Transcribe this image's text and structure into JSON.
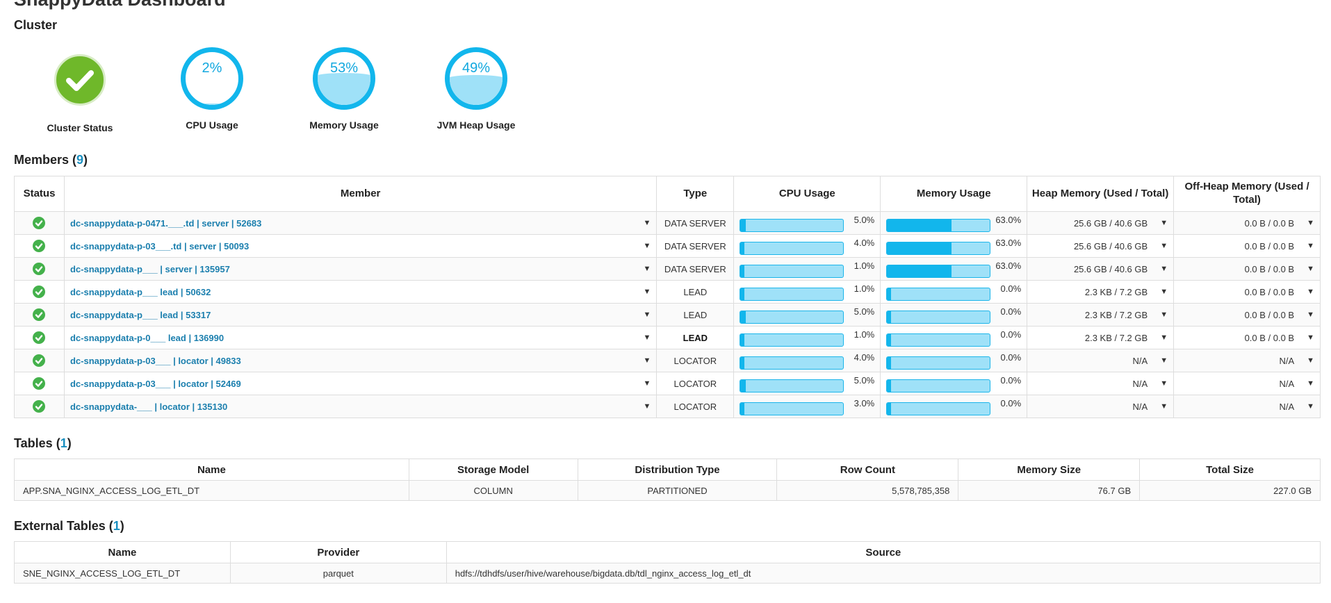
{
  "page": {
    "title": "SnappyData Dashboard"
  },
  "cluster": {
    "title": "Cluster",
    "gauges": [
      {
        "label": "Cluster Status",
        "icon": "check-icon"
      },
      {
        "label": "CPU Usage",
        "value": "2%",
        "fraction": 0.02
      },
      {
        "label": "Memory Usage",
        "value": "53%",
        "fraction": 0.53
      },
      {
        "label": "JVM Heap Usage",
        "value": "49%",
        "fraction": 0.49
      }
    ]
  },
  "members": {
    "title": "Members (",
    "count": "9",
    "close": ")",
    "columns": {
      "status": "Status",
      "member": "Member",
      "type": "Type",
      "cpu": "CPU Usage",
      "memory": "Memory Usage",
      "heap": "Heap Memory (Used / Total)",
      "offheap": "Off-Heap Memory (Used / Total)"
    },
    "rows": [
      {
        "name": "dc-snappydata-p-0471.___.td | server | 52683",
        "type": "DATA SERVER",
        "cpu": "5.0%",
        "cpu_frac": 0.05,
        "mem": "63.0%",
        "mem_frac": 0.63,
        "heap": "25.6 GB / 40.6 GB",
        "offheap": "0.0 B / 0.0 B"
      },
      {
        "name": "dc-snappydata-p-03___.td | server | 50093",
        "type": "DATA SERVER",
        "cpu": "4.0%",
        "cpu_frac": 0.04,
        "mem": "63.0%",
        "mem_frac": 0.63,
        "heap": "25.6 GB / 40.6 GB",
        "offheap": "0.0 B / 0.0 B"
      },
      {
        "name": "dc-snappydata-p___ | server | 135957",
        "type": "DATA SERVER",
        "cpu": "1.0%",
        "cpu_frac": 0.01,
        "mem": "63.0%",
        "mem_frac": 0.63,
        "heap": "25.6 GB / 40.6 GB",
        "offheap": "0.0 B / 0.0 B"
      },
      {
        "name": "dc-snappydata-p___ lead | 50632",
        "type": "LEAD",
        "cpu": "1.0%",
        "cpu_frac": 0.01,
        "mem": "0.0%",
        "mem_frac": 0,
        "heap": "2.3 KB / 7.2 GB",
        "offheap": "0.0 B / 0.0 B"
      },
      {
        "name": "dc-snappydata-p___ lead | 53317",
        "type": "LEAD",
        "cpu": "5.0%",
        "cpu_frac": 0.05,
        "mem": "0.0%",
        "mem_frac": 0,
        "heap": "2.3 KB / 7.2 GB",
        "offheap": "0.0 B / 0.0 B"
      },
      {
        "name": "dc-snappydata-p-0___ lead | 136990",
        "type": "LEAD",
        "cpu": "1.0%",
        "cpu_frac": 0.01,
        "mem": "0.0%",
        "mem_frac": 0,
        "heap": "2.3 KB / 7.2 GB",
        "offheap": "0.0 B / 0.0 B"
      },
      {
        "name": "dc-snappydata-p-03___ | locator | 49833",
        "type": "LOCATOR",
        "cpu": "4.0%",
        "cpu_frac": 0.04,
        "mem": "0.0%",
        "mem_frac": 0,
        "heap": "N/A",
        "offheap": "N/A"
      },
      {
        "name": "dc-snappydata-p-03___ | locator | 52469",
        "type": "LOCATOR",
        "cpu": "5.0%",
        "cpu_frac": 0.05,
        "mem": "0.0%",
        "mem_frac": 0,
        "heap": "N/A",
        "offheap": "N/A"
      },
      {
        "name": "dc-snappydata-___ | locator | 135130",
        "type": "LOCATOR",
        "cpu": "3.0%",
        "cpu_frac": 0.03,
        "mem": "0.0%",
        "mem_frac": 0,
        "heap": "N/A",
        "offheap": "N/A"
      }
    ]
  },
  "tables": {
    "title": "Tables (",
    "count": "1",
    "close": ")",
    "columns": [
      "Name",
      "Storage Model",
      "Distribution Type",
      "Row Count",
      "Memory Size",
      "Total Size"
    ],
    "rows": [
      {
        "name": "APP.SNA_NGINX_ACCESS_LOG_ETL_DT",
        "storage": "COLUMN",
        "distribution": "PARTITIONED",
        "rows": "5,578,785,358",
        "memory": "76.7 GB",
        "total": "227.0 GB"
      }
    ]
  },
  "external": {
    "title": "External Tables (",
    "count": "1",
    "close": ")",
    "columns": [
      "Name",
      "Provider",
      "Source"
    ],
    "rows": [
      {
        "name": "SNE_NGINX_ACCESS_LOG_ETL_DT",
        "provider": "parquet",
        "source": "hdfs://tdhdfs/user/hive/warehouse/bigdata.db/tdl_nginx_access_log_etl_dt"
      }
    ]
  },
  "colors": {
    "accent": "#12b6ec",
    "bar_bg": "#9fe1f8",
    "ok": "#44b14b",
    "link": "#1b7fae"
  }
}
